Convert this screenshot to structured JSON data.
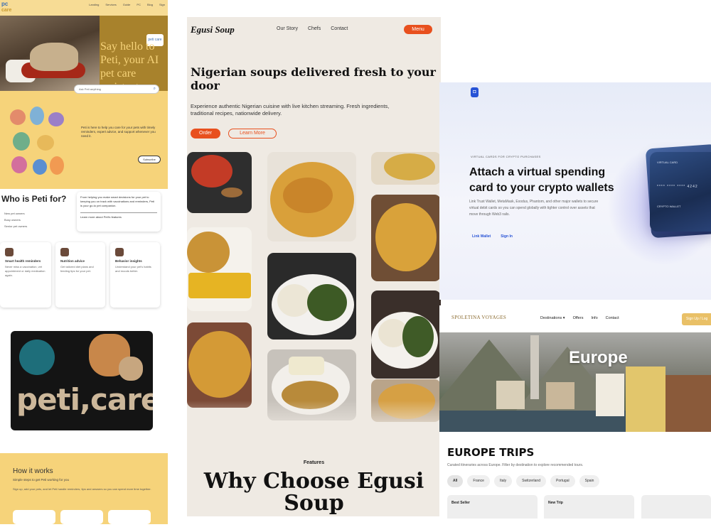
{
  "peti": {
    "logo_line1": "pc",
    "logo_line2": "care",
    "nav_links": [
      "Landing",
      "Services",
      "Guide",
      "PC",
      "Blog",
      "Sign"
    ],
    "hero_tagline": "Say hello to Peti, your AI pet care assistant.",
    "badge": "peti care",
    "search_placeholder": "Ask Peti anything",
    "help_text": "Peti is here to help you care for your pets with timely reminders, expert advice, and support whenever you need it.",
    "subscribe_button": "Subscribe",
    "who_title": "Who is Peti for?",
    "who_list": [
      "New pet owners",
      "Busy owners",
      "Senior pet owners"
    ],
    "info_text": "From helping you make smart decisions for your pet to keeping you on track with vaccinations and reminders, Peti is your go-to pet companion.",
    "info_link": "Learn more about Peti's features",
    "cards": [
      {
        "title": "Smart health reminders",
        "body": "Never miss a vaccination, vet appointment or daily medication again."
      },
      {
        "title": "Nutrition advice",
        "body": "Get tailored diet plans and feeding tips for your pet."
      },
      {
        "title": "Behavior insights",
        "body": "Understand your pet's habits and moods better."
      }
    ],
    "brand_text": "peti,care",
    "how_title": "How it works",
    "how_sub": "Simple steps to get Peti working for you",
    "how_par": "Sign up, add your pets, and let Peti handle reminders, tips and answers so you can spend more time together."
  },
  "egusi": {
    "logo": "Egusi Soup",
    "nav_links": [
      "Our Story",
      "Chefs",
      "Contact"
    ],
    "menu_button": "Menu",
    "headline": "Nigerian soups delivered fresh to your door",
    "description": "Experience authentic Nigerian cuisine with live kitchen streaming. Fresh ingredients, traditional recipes, nationwide delivery.",
    "order_button": "Order",
    "learn_button": "Learn More",
    "features_label": "Features",
    "why_heading": "Why Choose Egusi Soup"
  },
  "crypto": {
    "kicker": "VIRTUAL CARDS FOR CRYPTO PURCHASES",
    "headline": "Attach a virtual spending card to your crypto wallets",
    "body": "Link Trust Wallet, MetaMask, Exodus, Phantom, and other major wallets to secure virtual debit cards so you can spend globally with tighter control over assets that move through Web3 rails.",
    "link_wallet": "Link Wallet",
    "sign_in": "Sign In",
    "card_label": "VIRTUAL CARD",
    "card_number": "**** **** **** 4242",
    "card_holder": "CRYPTO WALLET"
  },
  "europe": {
    "logo": "SPOLETINA VOYAGES",
    "nav_links": [
      "Destinations ▾",
      "Offers",
      "Info",
      "Contact"
    ],
    "sign_up": "Sign Up / Log",
    "hero_title": "Europe",
    "trips_heading": "EUROPE TRIPS",
    "trips_sub": "Curated itineraries across Europe. Filter by destination to explore recommended tours.",
    "chips": [
      "All",
      "France",
      "Italy",
      "Switzerland",
      "Portugal",
      "Spain"
    ],
    "card_badges": [
      "Best Seller",
      "New Trip",
      ""
    ]
  }
}
